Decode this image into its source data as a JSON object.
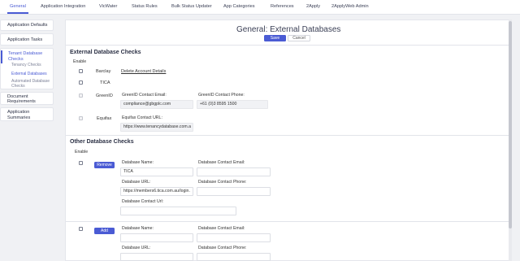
{
  "topnav": {
    "tabs": [
      "General",
      "Application Integration",
      "VicWater",
      "Status Rules",
      "Bulk Status Updater",
      "App Categories",
      "References",
      "2Apply",
      "2ApplyWeb Admin"
    ]
  },
  "sidebar": {
    "items": [
      {
        "label": "Application Defaults"
      },
      {
        "label": "Application Tasks"
      },
      {
        "label": "Tenant Database Checks",
        "subitems": [
          "Tenancy Checks",
          "External Databases",
          "Automated Database Checks"
        ]
      },
      {
        "label": "Document Requirements"
      },
      {
        "label": "Application Summaries"
      }
    ]
  },
  "header": {
    "title": "General: External Databases",
    "save_label": "Save",
    "cancel_label": "Cancel"
  },
  "external": {
    "title": "External Database Checks",
    "enable_label": "Enable",
    "rows": [
      {
        "name": "Barclay",
        "link": "Delete Account Details"
      },
      {
        "name": "TICA"
      },
      {
        "name": "GreenID",
        "email_label": "GreenID Contact Email:",
        "email_value": "compliance@gbgplc.com",
        "phone_label": "GreenID Contact Phone:",
        "phone_value": "+61 (0)3 8595 1500"
      },
      {
        "name": "Equifax",
        "url_label": "Equifax Contact URL:",
        "url_value": "https://www.tenancydatabase.com.a"
      }
    ]
  },
  "other": {
    "title": "Other Database Checks",
    "enable_label": "Enable",
    "entries": [
      {
        "button": "Remove",
        "name_label": "Database Name:",
        "name_value": "TICA",
        "email_label": "Database Contact Email:",
        "email_value": "",
        "url_label": "Database URL:",
        "url_value": "https://members6.tica.com.au/login.",
        "phone_label": "Database Contact Phone:",
        "phone_value": "",
        "contact_url_label": "Database Contact Url:",
        "contact_url_value": ""
      },
      {
        "button": "Add",
        "name_label": "Database Name:",
        "name_value": "",
        "email_label": "Database Contact Email:",
        "email_value": "",
        "url_label": "Database URL:",
        "url_value": "",
        "phone_label": "Database Contact Phone:",
        "phone_value": ""
      }
    ]
  },
  "colors": {
    "accent": "#4a5bd4",
    "panel": "#ffffff",
    "background": "#f0f1f4"
  }
}
